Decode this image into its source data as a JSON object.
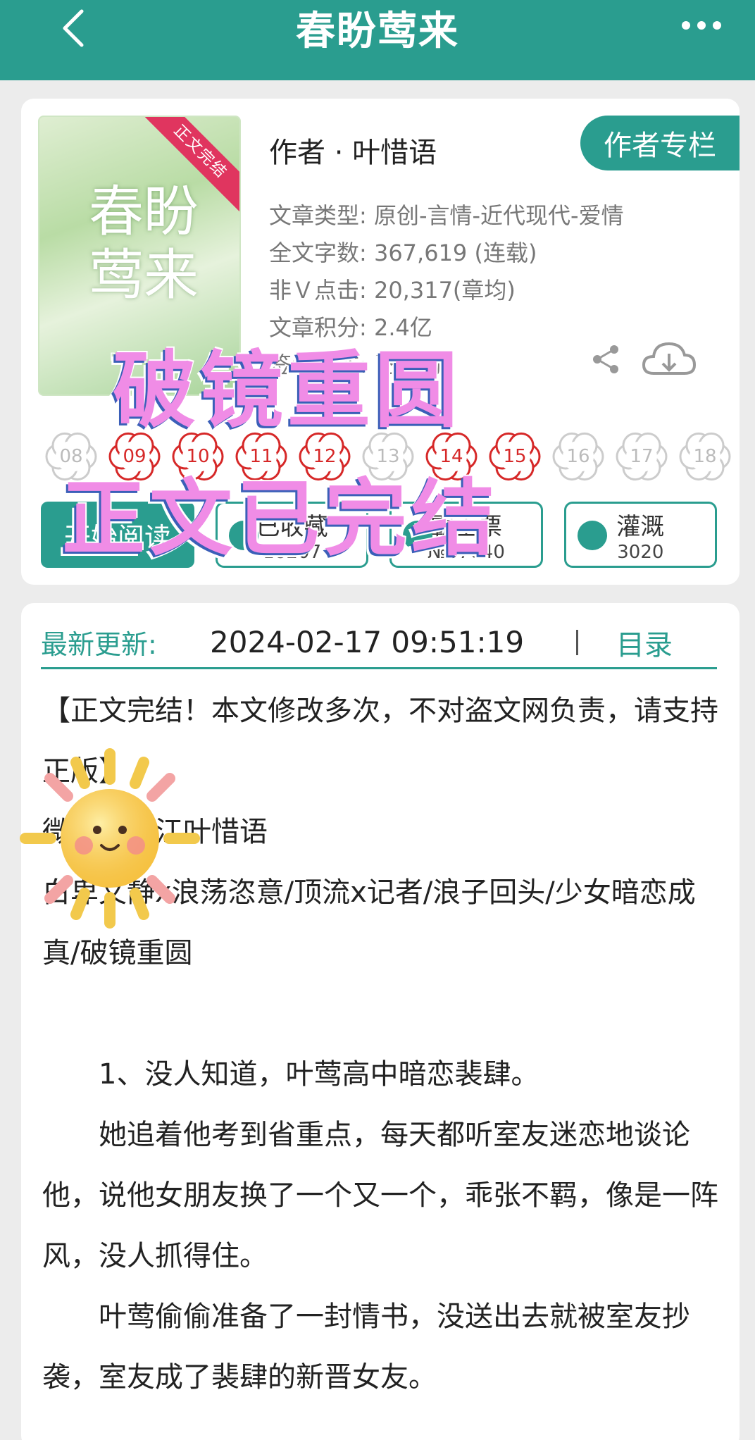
{
  "header": {
    "title": "春盼莺来",
    "back_icon": "chevron-left-icon",
    "more_icon": "more-dots-icon"
  },
  "book": {
    "cover_title": "春盼莺来",
    "cover_badge": "正文完结",
    "cover_author": "叶惜语",
    "author_line": "作者 · 叶惜语",
    "author_column_button": "作者专栏",
    "type_line": "文章类型: 原创-言情-近代现代-爱情",
    "words_line": "全文字数: 367,619 (连载)",
    "clicks_line": "非Ｖ点击: 20,317(章均)",
    "score_line": "文章积分: 2.4亿",
    "status_line": "签约状态: 已签约"
  },
  "dates": [
    {
      "label": "08",
      "hot": false
    },
    {
      "label": "09",
      "hot": true
    },
    {
      "label": "10",
      "hot": true
    },
    {
      "label": "11",
      "hot": true
    },
    {
      "label": "12",
      "hot": true
    },
    {
      "label": "13",
      "hot": false
    },
    {
      "label": "14",
      "hot": true
    },
    {
      "label": "15",
      "hot": true
    },
    {
      "label": "16",
      "hot": false
    },
    {
      "label": "17",
      "hot": false
    },
    {
      "label": "18",
      "hot": false
    }
  ],
  "actions": {
    "read_button": "开始阅读",
    "collect_label": "已收藏",
    "collect_count": "18207",
    "rank_label": "霸王票",
    "rank_count": "№57640",
    "water_label": "灌溉",
    "water_count": "3020"
  },
  "update": {
    "label": "最新更新:",
    "time": "2024-02-17 09:51:19",
    "toc": "目录"
  },
  "intro": {
    "p1": "【正文完结！本文修改多次，不对盗文网负责，请支持正版】",
    "p2": "微博：晋江叶惜语",
    "p3": "白卑文静x浪荡恣意/顶流x记者/浪子回头/少女暗恋成真/破镜重圆",
    "p4": "1、没人知道，叶莺高中暗恋裴肆。",
    "p5": "她追着他考到省重点，每天都听室友迷恋地谈论他，说他女朋友换了一个又一个，乖张不羁，像是一阵风，没人抓得住。",
    "p6": "叶莺偷偷准备了一封情书，没送出去就被室友抄袭，室友成了裴肆的新晋女友。"
  },
  "overlay": {
    "line1": "破镜重圆",
    "line2": "正文已完结"
  },
  "colors": {
    "brand": "#2a9d8f",
    "hot_date": "#d62828",
    "sticker": "#f08ce6"
  }
}
